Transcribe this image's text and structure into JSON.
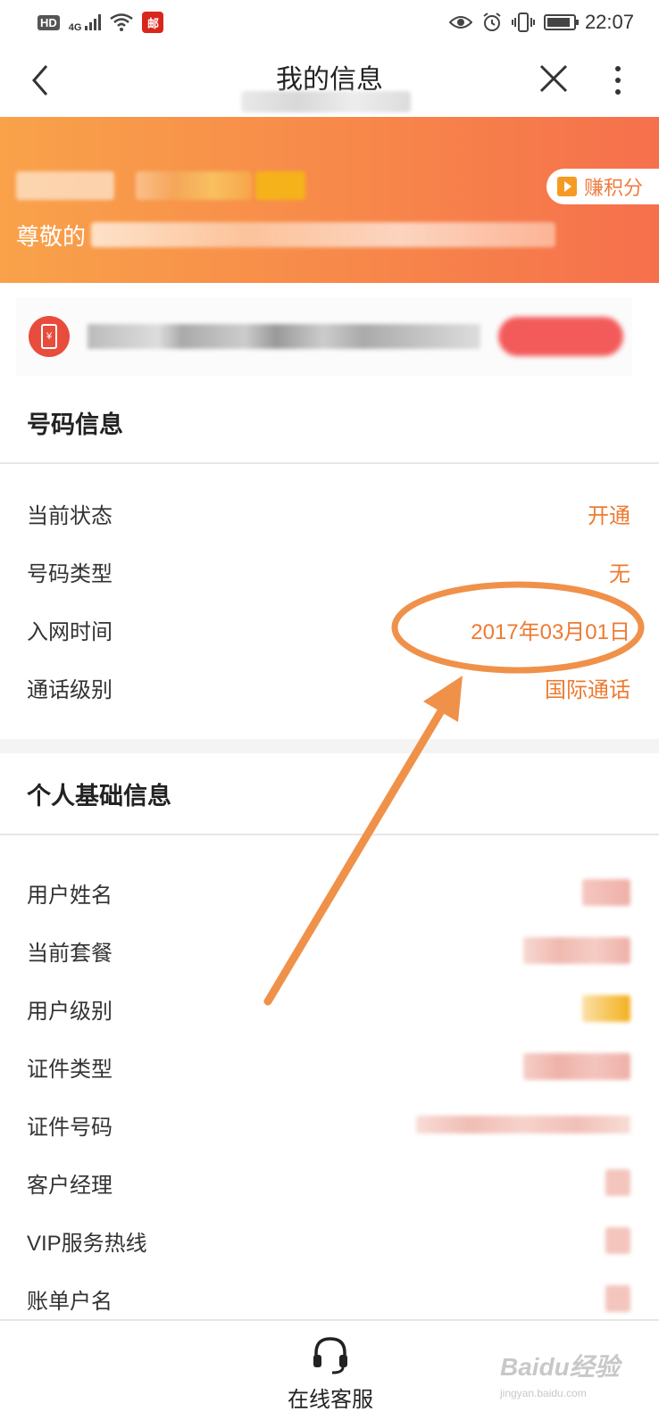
{
  "status_bar": {
    "network_hd": "HD",
    "network_4g": "4G",
    "app_badge": "邮",
    "time": "22:07",
    "battery_level": 0.9
  },
  "nav": {
    "title": "我的信息"
  },
  "banner": {
    "earn_points": "赚积分",
    "greeting_prefix": "尊敬的"
  },
  "number_info": {
    "title": "号码信息",
    "rows": [
      {
        "label": "当前状态",
        "value": "开通"
      },
      {
        "label": "号码类型",
        "value": "无"
      },
      {
        "label": "入网时间",
        "value": "2017年03月01日"
      },
      {
        "label": "通话级别",
        "value": "国际通话"
      }
    ]
  },
  "personal_info": {
    "title": "个人基础信息",
    "rows": [
      {
        "label": "用户姓名"
      },
      {
        "label": "当前套餐"
      },
      {
        "label": "用户级别"
      },
      {
        "label": "证件类型"
      },
      {
        "label": "证件号码"
      },
      {
        "label": "客户经理"
      },
      {
        "label": "VIP服务热线"
      },
      {
        "label": "账单户名"
      }
    ]
  },
  "bottom": {
    "customer_service": "在线客服"
  },
  "watermark": {
    "brand": "Baidu经验",
    "url": "jingyan.baidu.com"
  },
  "colors": {
    "accent": "#ee7a30",
    "banner_start": "#f9a24a",
    "banner_end": "#f6704c",
    "annotation": "#f0914a"
  },
  "icons": [
    "back-arrow-icon",
    "close-icon",
    "more-vertical-icon",
    "play-icon",
    "phone-payment-icon",
    "headset-icon"
  ]
}
